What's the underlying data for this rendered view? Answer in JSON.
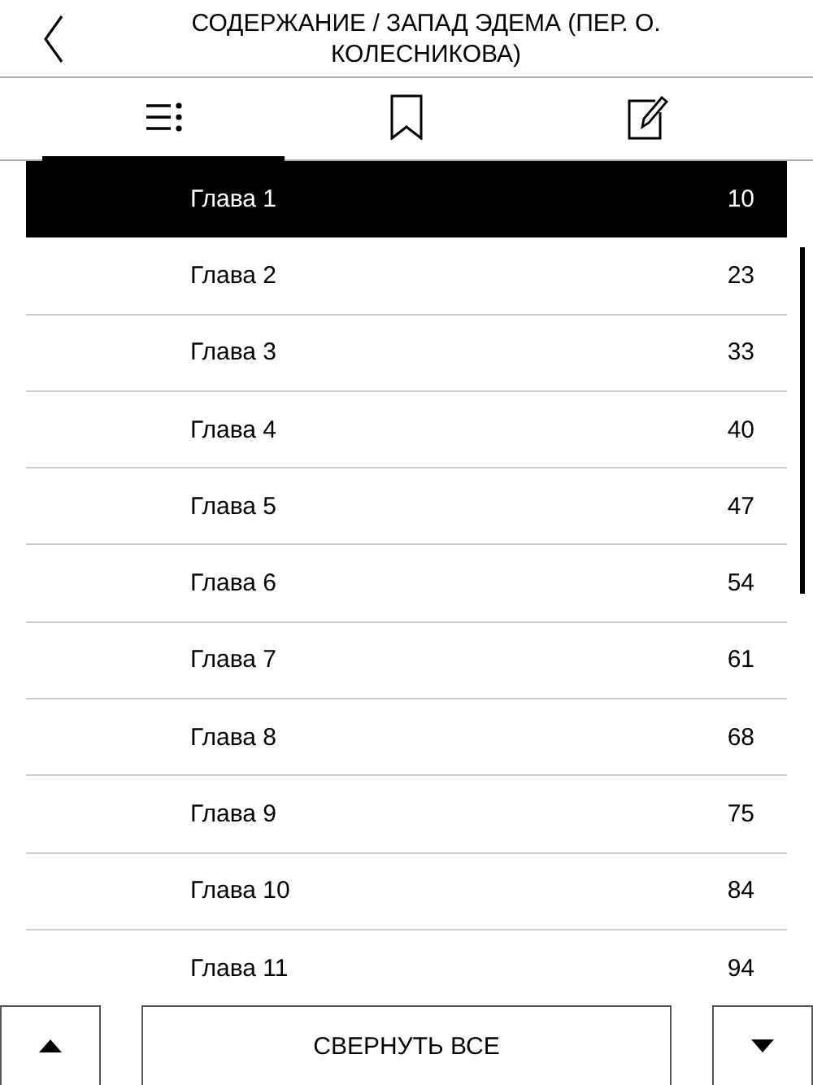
{
  "header": {
    "title": "СОДЕРЖАНИЕ / ЗАПАД ЭДЕМА (ПЕР. О. КОЛЕСНИКОВА)"
  },
  "tabs": [
    {
      "kind": "contents",
      "selected": true
    },
    {
      "kind": "bookmarks",
      "selected": false
    },
    {
      "kind": "notes",
      "selected": false
    }
  ],
  "chapters": [
    {
      "title": "Глава 1",
      "page": "10",
      "selected": true
    },
    {
      "title": "Глава 2",
      "page": "23",
      "selected": false
    },
    {
      "title": "Глава 3",
      "page": "33",
      "selected": false
    },
    {
      "title": "Глава 4",
      "page": "40",
      "selected": false
    },
    {
      "title": "Глава 5",
      "page": "47",
      "selected": false
    },
    {
      "title": "Глава 6",
      "page": "54",
      "selected": false
    },
    {
      "title": "Глава 7",
      "page": "61",
      "selected": false
    },
    {
      "title": "Глава 8",
      "page": "68",
      "selected": false
    },
    {
      "title": "Глава 9",
      "page": "75",
      "selected": false
    },
    {
      "title": "Глава 10",
      "page": "84",
      "selected": false
    },
    {
      "title": "Глава 11",
      "page": "94",
      "selected": false
    }
  ],
  "footer": {
    "collapse_button": "СВЕРНУТЬ ВСЕ"
  }
}
